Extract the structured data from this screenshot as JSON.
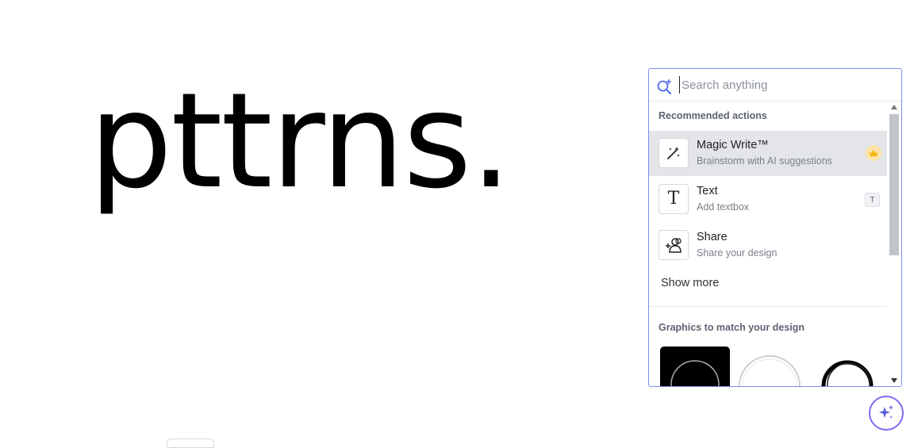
{
  "canvas": {
    "text": "pttrns."
  },
  "search": {
    "placeholder": "Search anything"
  },
  "recommended": {
    "title": "Recommended actions",
    "items": [
      {
        "title": "Magic Write™",
        "subtitle": "Brainstorm with AI suggestions",
        "icon": "magic-wand-icon",
        "badge": "crown-icon"
      },
      {
        "title": "Text",
        "subtitle": "Add textbox",
        "icon": "text-icon",
        "shortcut": "T"
      },
      {
        "title": "Share",
        "subtitle": "Share your design",
        "icon": "share-people-icon"
      }
    ],
    "show_more": "Show more"
  },
  "graphics": {
    "title": "Graphics to match your design"
  },
  "colors": {
    "accent": "#7d6af2",
    "panel_border": "#7d8cf0",
    "crown": "#f4b400",
    "highlight": "#e3e5e8"
  }
}
